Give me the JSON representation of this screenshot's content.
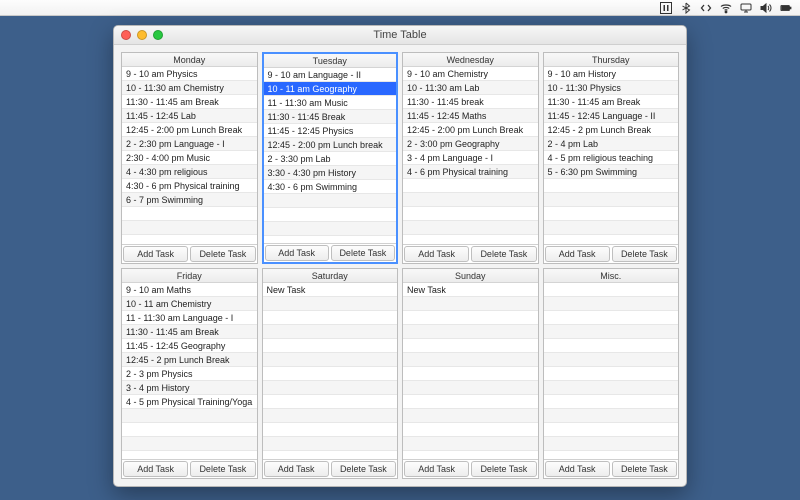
{
  "menubar_icons": [
    "pause-icon",
    "bluetooth-icon",
    "code-icon",
    "wifi-icon",
    "display-icon",
    "volume-icon",
    "battery-icon"
  ],
  "window": {
    "title": "Time Table"
  },
  "buttons": {
    "add": "Add Task",
    "delete": "Delete Task"
  },
  "columns": [
    {
      "name": "Monday",
      "selected": false,
      "tasks": [
        "9 - 10 am Physics",
        "10 - 11:30 am Chemistry",
        "11:30 - 11:45 am Break",
        "11:45 - 12:45 Lab",
        "12:45 - 2:00 pm Lunch Break",
        "2 - 2:30 pm Language - I",
        "2:30 - 4:00 pm Music",
        "4 - 4:30 pm religious",
        "4:30 - 6 pm Physical training",
        "6 - 7 pm Swimming"
      ]
    },
    {
      "name": "Tuesday",
      "selected": true,
      "tasks": [
        "9 - 10 am Language - II",
        "10 - 11 am Geography",
        "11 - 11:30 am Music",
        "11:30 - 11:45 Break",
        "11:45 - 12:45 Physics",
        "12:45 - 2:00 pm Lunch break",
        "2 - 3:30 pm Lab",
        "3:30 - 4:30 pm History",
        "4:30 - 6 pm Swimming"
      ],
      "selected_task_index": 1
    },
    {
      "name": "Wednesday",
      "selected": false,
      "tasks": [
        "9 - 10 am Chemistry",
        "10 - 11:30 am Lab",
        "11:30 - 11:45 break",
        "11:45 - 12:45 Maths",
        "12:45 - 2:00 pm Lunch Break",
        "2 - 3:00 pm Geography",
        "3 - 4 pm Language - I",
        "4 - 6 pm Physical training"
      ]
    },
    {
      "name": "Thursday",
      "selected": false,
      "tasks": [
        "9 - 10 am History",
        "10 - 11:30 Physics",
        "11:30 - 11:45 am Break",
        "11:45 - 12:45 Language - II",
        "12:45 - 2 pm Lunch Break",
        "2 - 4 pm Lab",
        "4 - 5 pm religious teaching",
        "5 - 6:30 pm Swimming"
      ]
    },
    {
      "name": "Friday",
      "selected": false,
      "tasks": [
        "9 - 10 am Maths",
        "10 - 11 am Chemistry",
        "11 - 11:30 am Language - I",
        "11:30 - 11:45 am Break",
        "11:45 - 12:45 Geography",
        "12:45 - 2 pm Lunch Break",
        "2 - 3 pm Physics",
        "3 - 4 pm History",
        "4 - 5 pm Physical Training/Yoga"
      ]
    },
    {
      "name": "Saturday",
      "selected": false,
      "tasks": [
        "New Task"
      ]
    },
    {
      "name": "Sunday",
      "selected": false,
      "tasks": [
        "New Task"
      ]
    },
    {
      "name": "Misc.",
      "selected": false,
      "tasks": []
    }
  ]
}
